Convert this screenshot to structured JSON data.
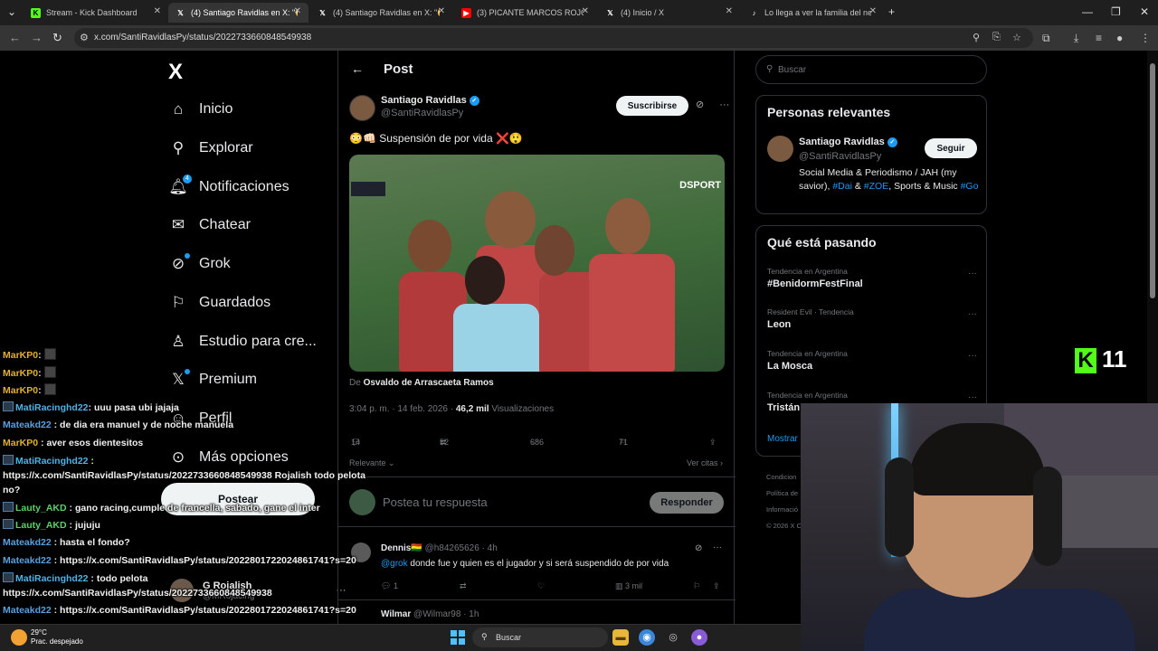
{
  "browser": {
    "tabs": [
      {
        "title": "Stream - Kick Dashboard",
        "favicon": "kick-icon"
      },
      {
        "title": "(4) Santiago Ravidlas en X: \"😳 •",
        "favicon": "x-icon"
      },
      {
        "title": "(4) Santiago Ravidlas en X: \"😳",
        "favicon": "x-icon"
      },
      {
        "title": "(3) PICANTE MARCOS ROJO CO",
        "favicon": "youtube-icon"
      },
      {
        "title": "(4) Inicio / X",
        "favicon": "x-icon"
      },
      {
        "title": "Lo llega a ver la familia del nen",
        "favicon": "tiktok-icon"
      }
    ],
    "url": "x.com/SantiRavidlasPy/status/2022733660848549938"
  },
  "nav": {
    "logo": "X",
    "items": [
      {
        "label": "Inicio",
        "icon": "home-icon"
      },
      {
        "label": "Explorar",
        "icon": "search-icon"
      },
      {
        "label": "Notificaciones",
        "icon": "bell-icon",
        "badge": "4"
      },
      {
        "label": "Chatear",
        "icon": "mail-icon"
      },
      {
        "label": "Grok",
        "icon": "grok-icon"
      },
      {
        "label": "Guardados",
        "icon": "bookmark-icon"
      },
      {
        "label": "Estudio para cre...",
        "icon": "studio-icon"
      },
      {
        "label": "Premium",
        "icon": "x-premium-icon"
      },
      {
        "label": "Perfil",
        "icon": "person-icon"
      },
      {
        "label": "Más opciones",
        "icon": "more-circle-icon"
      }
    ],
    "post_button": "Postear",
    "account": {
      "name": "G Rojalish",
      "handle": "@MRojacing"
    }
  },
  "post": {
    "header": "Post",
    "author_name": "Santiago Ravidlas",
    "author_handle": "@SantiRavidlasPy",
    "subscribe": "Suscribirse",
    "text": "😳👊🏻 Suspensión de por vida ❌😲",
    "media_watermark": "DSPORT",
    "from_label": "De",
    "from_name": "Osvaldo de Arrascaeta Ramos",
    "time": "3:04 p. m. · 14 feb. 2026 · ",
    "views_count": "46,2 mil",
    "views_label": " Visualizaciones",
    "stats": {
      "replies": "14",
      "reposts": "52",
      "likes": "686",
      "bookmarks": "71"
    },
    "sort_label": "Relevante",
    "quotes_label": "Ver citas",
    "reply_placeholder": "Postea tu respuesta",
    "reply_button": "Responder"
  },
  "comments": [
    {
      "name": "Dennis🇧🇴",
      "handle": "@h84265626 · 4h",
      "mention": "@grok",
      "text": " donde fue y quien es el jugador y si será suspendido de por vida",
      "replies": "1",
      "views": "3 mil"
    },
    {
      "name": "Wilmar",
      "handle": "@Wilmar98 · 1h"
    }
  ],
  "sidebar": {
    "search_placeholder": "Buscar",
    "relevant_title": "Personas relevantes",
    "person": {
      "name": "Santiago Ravidlas",
      "handle": "@SantiRavidlasPy",
      "follow": "Seguir",
      "bio_a": "Social Media & Periodismo / JAH (my savior), ",
      "tag1": "#Dai",
      "bio_b": " & ",
      "tag2": "#ZOE",
      "bio_c": ", Sports & Music ",
      "tag3": "#Go"
    },
    "trending_title": "Qué está pasando",
    "trends": [
      {
        "context": "Tendencia en Argentina",
        "topic": "#BenidormFestFinal"
      },
      {
        "context": "Resident Evil · Tendencia",
        "topic": "Leon"
      },
      {
        "context": "Tendencia en Argentina",
        "topic": "La Mosca"
      },
      {
        "context": "Tendencia en Argentina",
        "topic": "Tristán"
      }
    ],
    "show_more": "Mostrar",
    "footer": [
      "Condicion",
      "Política de",
      "Informació",
      "© 2026 X C"
    ]
  },
  "chat": [
    {
      "user": "MarKP0",
      "msg": "",
      "emote": true,
      "style": "cu"
    },
    {
      "user": "MarKP0",
      "msg": "",
      "emote": true,
      "style": "cu"
    },
    {
      "user": "MarKP0",
      "msg": "",
      "emote": true,
      "style": "cu"
    },
    {
      "user": "MatiRacinghd22",
      "msg": "uuu pasa ubi jajaja",
      "badge": true,
      "style": "cu b"
    },
    {
      "user": "Mateakd22",
      "msg": "de dia era manuel y de noche manuela",
      "style": "cu bl"
    },
    {
      "user": "MarKP0",
      "msg": "aver esos dientesitos",
      "style": "cu"
    },
    {
      "user": "MatiRacinghd22",
      "msg": "",
      "badge": true,
      "style": "cu b"
    },
    {
      "user": "",
      "msg": "https://x.com/SantiRavidlasPy/status/2022733660848549938 Rojalish todo pelota",
      "style": "cu"
    },
    {
      "user": "",
      "msg": "no?",
      "style": "cu"
    },
    {
      "user": "Lauty_AKD",
      "msg": "gano racing,cumple de francella, sabado, gane el inter",
      "badge": true,
      "style": "cu g"
    },
    {
      "user": "Lauty_AKD",
      "msg": "jujuju",
      "badge": true,
      "style": "cu g"
    },
    {
      "user": "Mateakd22",
      "msg": "hasta el fondo?",
      "style": "cu bl"
    },
    {
      "user": "Mateakd22",
      "msg": "https://x.com/SantiRavidlasPy/status/2022801722024861741?s=20",
      "style": "cu bl"
    },
    {
      "user": "MatiRacinghd22",
      "msg": "todo pelota",
      "badge": true,
      "style": "cu b"
    },
    {
      "user": "",
      "msg": "https://x.com/SantiRavidlasPy/status/2022733660848549938",
      "style": "cu"
    },
    {
      "user": "Mateakd22",
      "msg": "https://x.com/SantiRavidlasPy/status/2022801722024861741?s=20",
      "style": "cu bl"
    }
  ],
  "kick_overlay": {
    "logo": "K",
    "count": "11"
  },
  "taskbar": {
    "temp": "29°C",
    "weather": "Prac. despejado",
    "search": "Buscar"
  }
}
